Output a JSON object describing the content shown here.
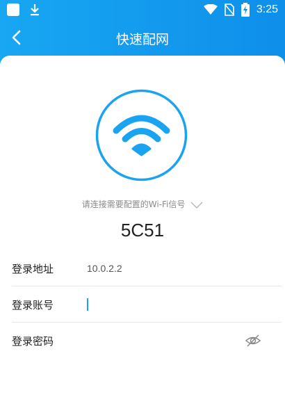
{
  "status_bar": {
    "time": "3:25"
  },
  "header": {
    "title": "快速配网"
  },
  "wifi": {
    "prompt": "请连接需要配置的Wi-Fi信号",
    "ssid": "5C51"
  },
  "form": {
    "login_address": {
      "label": "登录地址",
      "value": "10.0.2.2"
    },
    "login_account": {
      "label": "登录账号",
      "value": ""
    },
    "login_password": {
      "label": "登录密码",
      "value": ""
    }
  },
  "colors": {
    "accent": "#1aa3f0",
    "header_start": "#18a7f2",
    "header_end": "#0e8fea"
  },
  "icons": [
    "back-arrow-icon",
    "wifi-icon",
    "chevron-down-icon",
    "eye-hidden-icon"
  ]
}
